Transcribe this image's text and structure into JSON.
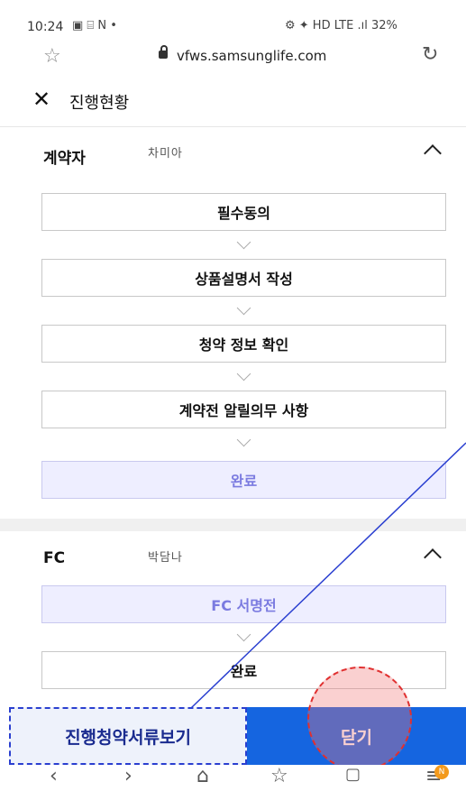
{
  "status_bar": {
    "time": "10:24",
    "left_icons": "▣ ⌸ N •",
    "right_text": "⚙ ✦ HD LTE .ıl 32%"
  },
  "browser": {
    "url": "vfws.samsunglife.com"
  },
  "header": {
    "title": "진행현황"
  },
  "sections": [
    {
      "label": "계약자",
      "name": "차미아",
      "steps": [
        {
          "label": "필수동의",
          "done": false
        },
        {
          "label": "상품설명서 작성",
          "done": false
        },
        {
          "label": "청약 정보 확인",
          "done": false
        },
        {
          "label": "계약전 알릴의무 사항",
          "done": false
        },
        {
          "label": "완료",
          "done": true
        }
      ]
    },
    {
      "label": "FC",
      "name": "박담나",
      "steps": [
        {
          "label": "FC 서명전",
          "done": true
        },
        {
          "label": "완료",
          "done": false
        }
      ]
    }
  ],
  "bottom_buttons": {
    "left_label": "진행청약서류보기",
    "right_label": "닫기"
  },
  "colors": {
    "primary_blue": "#1565e0",
    "done_bg": "#eeeeff",
    "done_text": "#7b7be0",
    "annotation_blue": "#2a3fd0",
    "annotation_red": "#e03030"
  }
}
